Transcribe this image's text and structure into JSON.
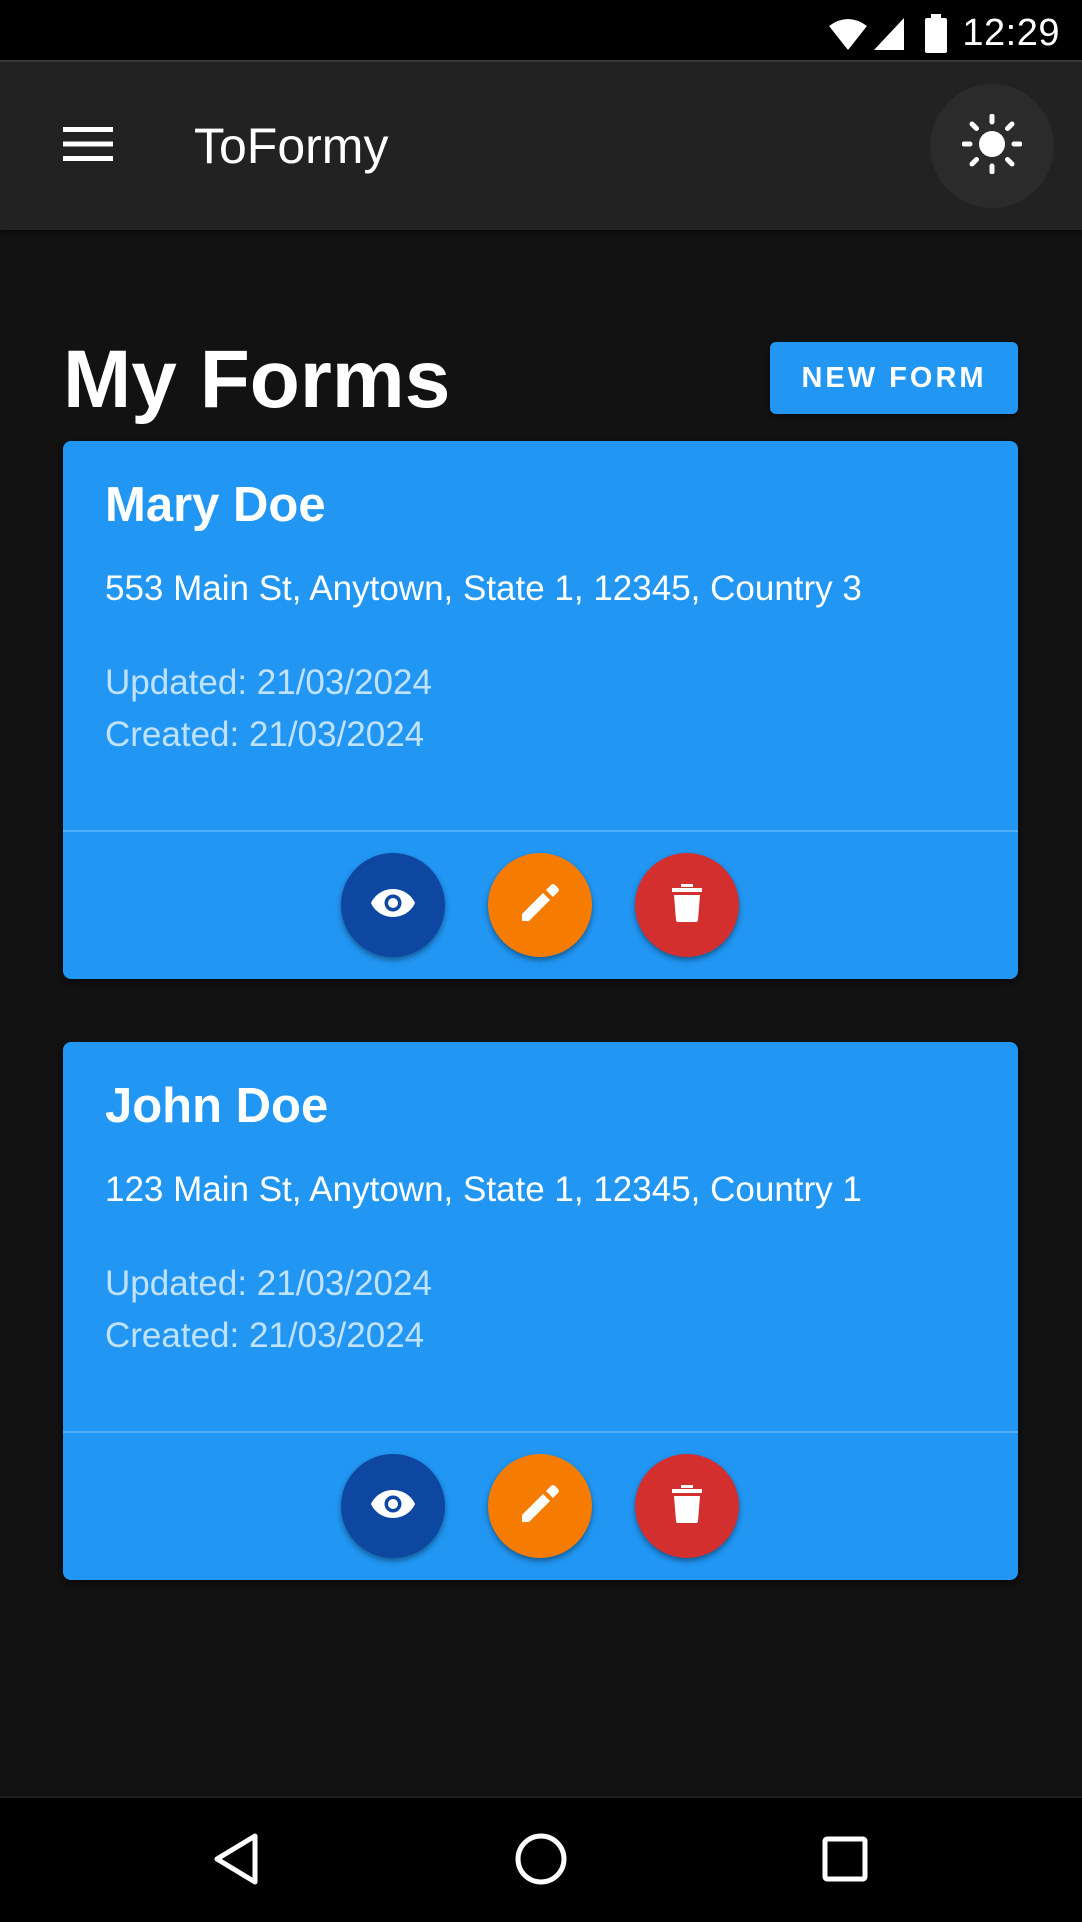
{
  "status_bar": {
    "time": "12:29"
  },
  "app_bar": {
    "title": "ToFormy"
  },
  "page": {
    "title": "My Forms",
    "new_form_label": "NEW FORM"
  },
  "forms": [
    {
      "name": "Mary Doe",
      "address": "553 Main St, Anytown, State 1, 12345, Country 3",
      "updated": "Updated: 21/03/2024",
      "created": "Created: 21/03/2024"
    },
    {
      "name": "John Doe",
      "address": "123 Main St, Anytown, State 1, 12345, Country 1",
      "updated": "Updated: 21/03/2024",
      "created": "Created: 21/03/2024"
    }
  ],
  "colors": {
    "background": "#121212",
    "app_bar": "#222222",
    "primary": "#2196f3",
    "view_button": "#0d47a1",
    "edit_button": "#f57c00",
    "delete_button": "#d32f2f"
  },
  "icons": {
    "menu": "menu-icon",
    "theme": "sun-icon",
    "view": "eye-icon",
    "edit": "pencil-icon",
    "delete": "trash-icon"
  }
}
